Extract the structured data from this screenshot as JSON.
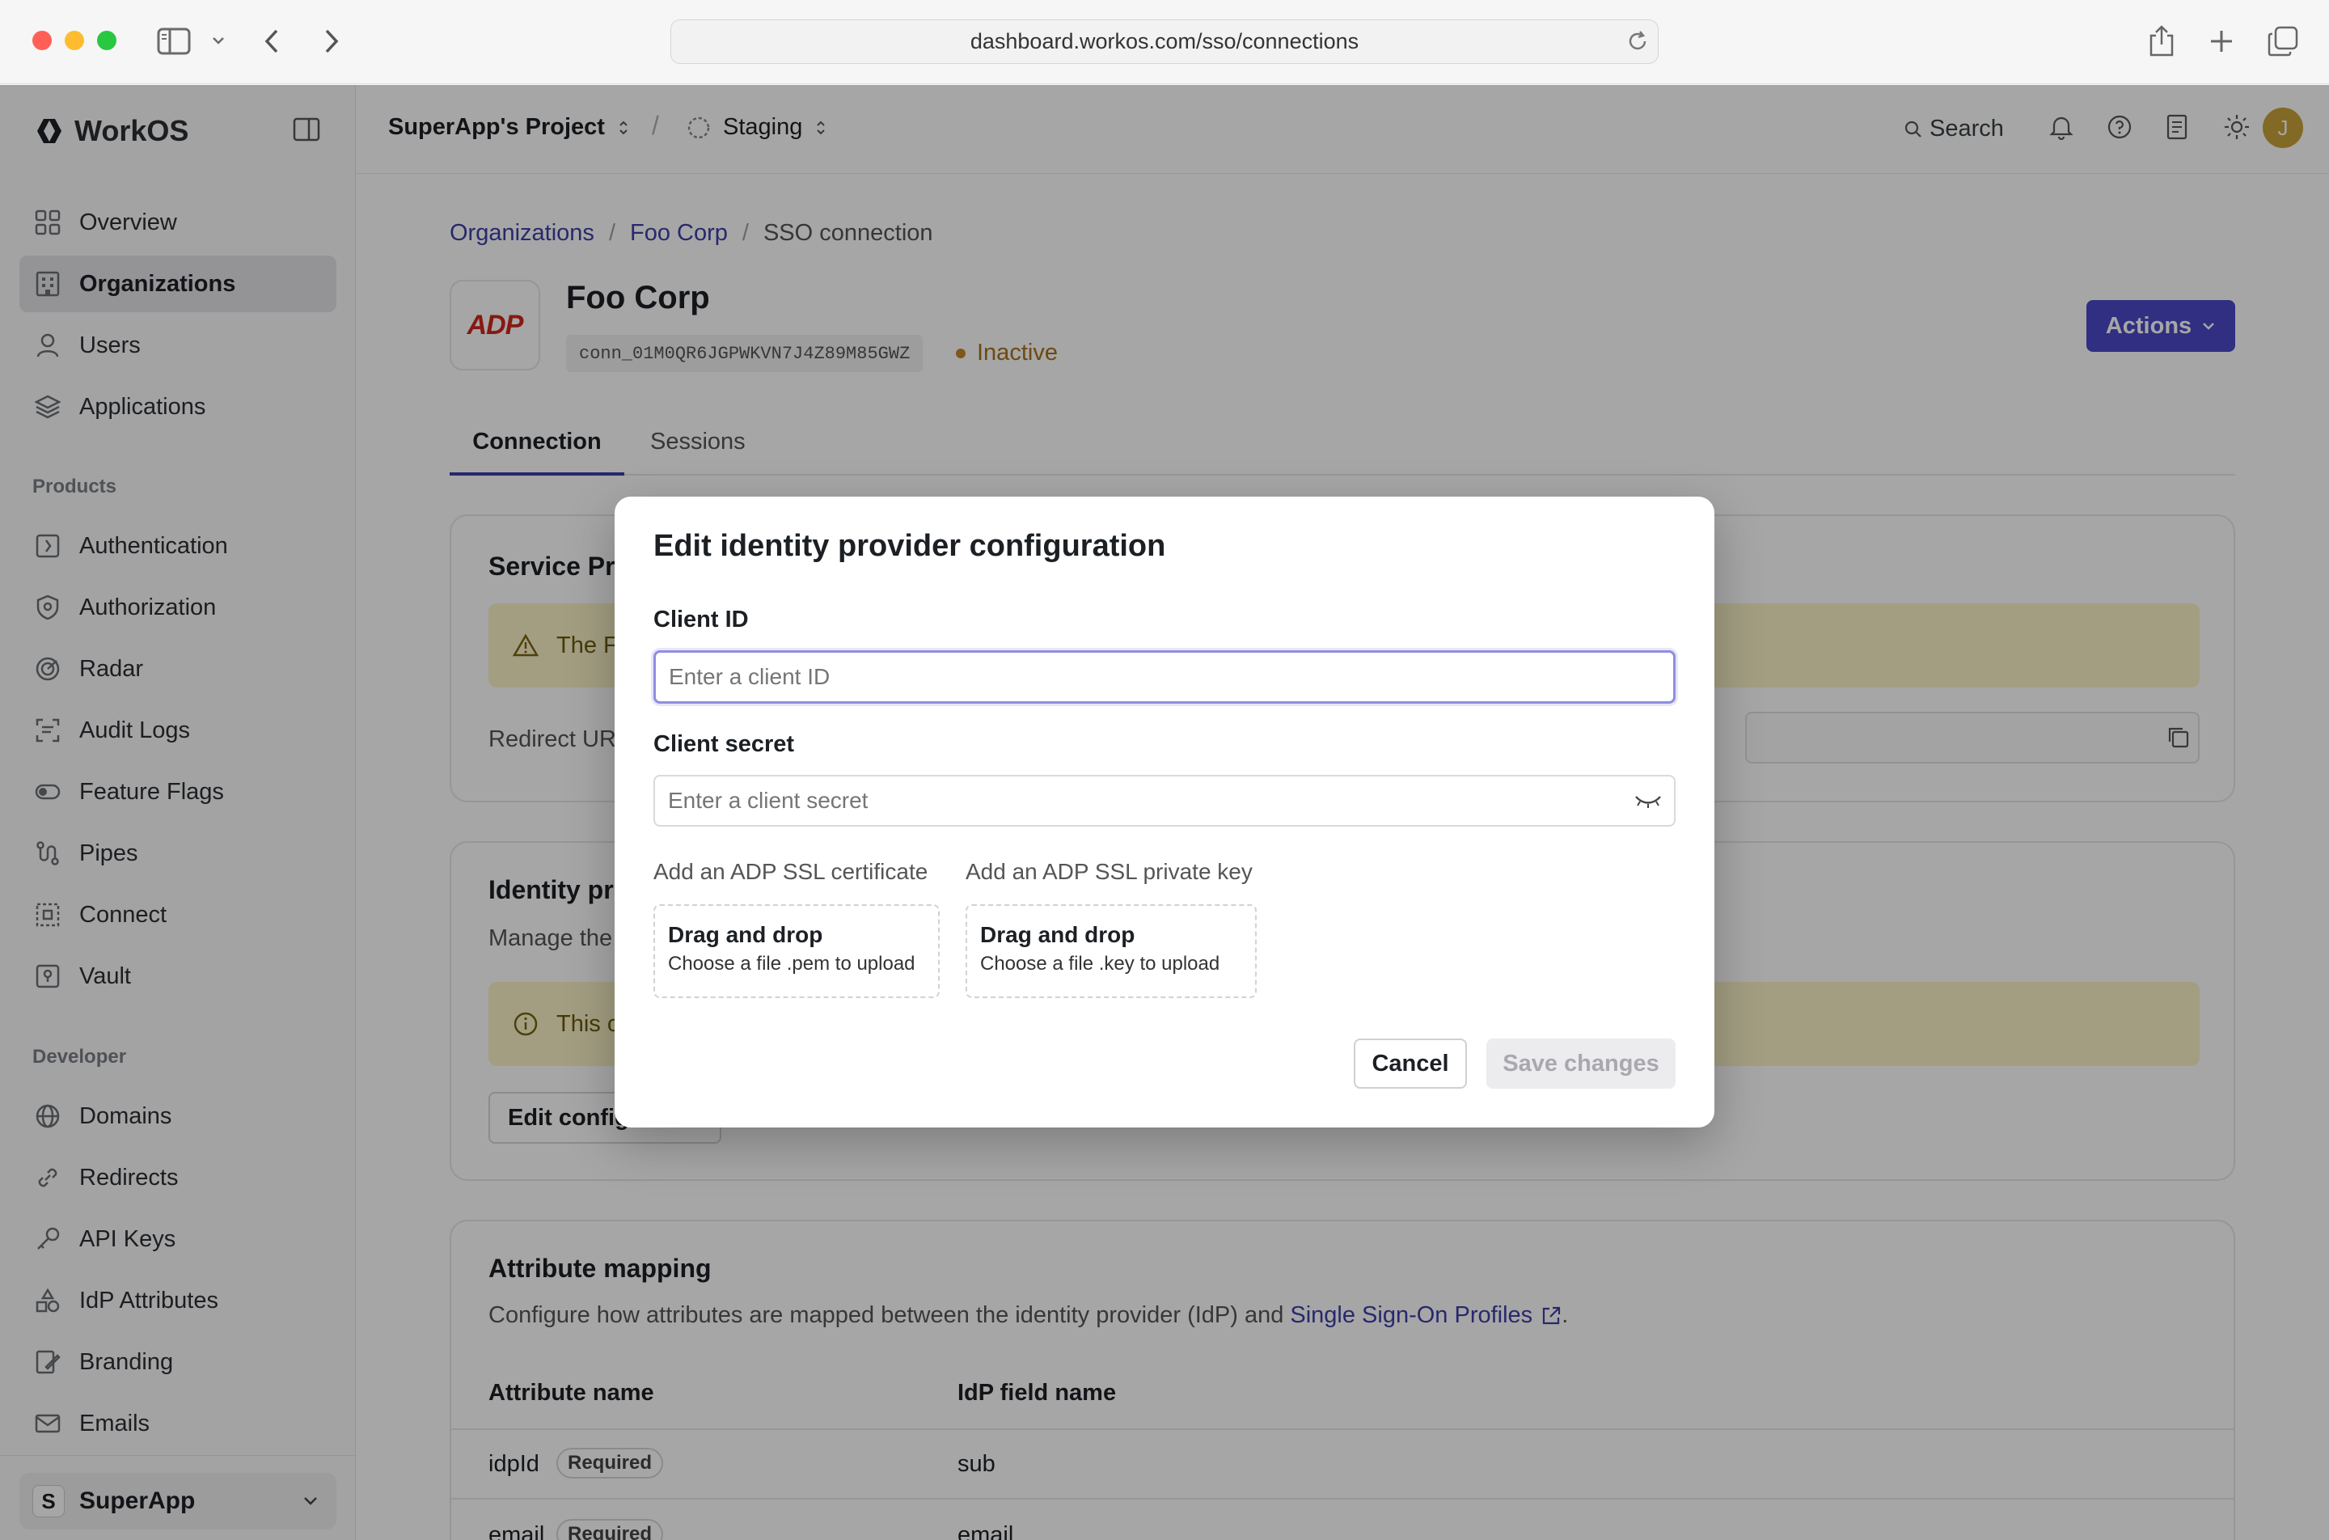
{
  "browser": {
    "url": "dashboard.workos.com/sso/connections"
  },
  "sidebar": {
    "brand": "WorkOS",
    "main_items": [
      {
        "label": "Overview",
        "icon": "grid-icon"
      },
      {
        "label": "Organizations",
        "icon": "building-icon",
        "active": true
      },
      {
        "label": "Users",
        "icon": "user-icon"
      },
      {
        "label": "Applications",
        "icon": "layers-icon"
      }
    ],
    "products_label": "Products",
    "product_items": [
      {
        "label": "Authentication",
        "icon": "key-icon"
      },
      {
        "label": "Authorization",
        "icon": "shield-icon"
      },
      {
        "label": "Radar",
        "icon": "radar-icon"
      },
      {
        "label": "Audit Logs",
        "icon": "audit-icon"
      },
      {
        "label": "Feature Flags",
        "icon": "toggle-icon"
      },
      {
        "label": "Pipes",
        "icon": "pipes-icon"
      },
      {
        "label": "Connect",
        "icon": "connect-icon"
      },
      {
        "label": "Vault",
        "icon": "vault-icon"
      }
    ],
    "developer_label": "Developer",
    "developer_items": [
      {
        "label": "Domains",
        "icon": "globe-icon"
      },
      {
        "label": "Redirects",
        "icon": "link-icon"
      },
      {
        "label": "API Keys",
        "icon": "api-key-icon"
      },
      {
        "label": "IdP Attributes",
        "icon": "shapes-icon"
      },
      {
        "label": "Branding",
        "icon": "brush-icon"
      },
      {
        "label": "Emails",
        "icon": "mail-icon"
      }
    ],
    "workspace_initial": "S",
    "workspace_name": "SuperApp"
  },
  "topbar": {
    "project": "SuperApp's Project",
    "separator": "/",
    "environment": "Staging",
    "search_label": "Search",
    "avatar_initial": "J"
  },
  "breadcrumb": {
    "items": [
      "Organizations",
      "Foo Corp",
      "SSO connection"
    ],
    "separator": "/"
  },
  "header": {
    "logo_text": "ADP",
    "title": "Foo Corp",
    "connection_id": "conn_01M0QR6JGPWKVN7J4Z89M85GWZ",
    "status": "Inactive",
    "status_color": "#c2882a",
    "actions_label": "Actions",
    "accent": "#4b49c8"
  },
  "tabs": [
    {
      "label": "Connection",
      "active": true
    },
    {
      "label": "Sessions",
      "active": false
    }
  ],
  "service_provider_card": {
    "title_partial": "Service Pr",
    "warning_partial": "The F",
    "redirect_label_partial": "Redirect UR"
  },
  "identity_card": {
    "title_partial": "Identity pr",
    "subtitle_partial": "Manage the",
    "info_partial": "This c",
    "edit_button_partial": "Edit config"
  },
  "attribute_mapping": {
    "title": "Attribute mapping",
    "description": "Configure how attributes are mapped between the identity provider (IdP) and",
    "link_text": "Single Sign-On Profiles",
    "period": ".",
    "columns": [
      "Attribute name",
      "IdP field name"
    ],
    "rows": [
      {
        "name": "idpId",
        "badge": "Required",
        "field": "sub"
      },
      {
        "name": "email",
        "badge": "Required",
        "field": "email"
      }
    ]
  },
  "modal": {
    "title": "Edit identity provider configuration",
    "client_id_label": "Client ID",
    "client_id_placeholder": "Enter a client ID",
    "client_secret_label": "Client secret",
    "client_secret_placeholder": "Enter a client secret",
    "cert_label": "Add an ADP SSL certificate",
    "key_label": "Add an ADP SSL private key",
    "cert_drop_title": "Drag and drop",
    "cert_drop_hint": "Choose a file .pem to upload",
    "key_drop_title": "Drag and drop",
    "key_drop_hint": "Choose a file .key to upload",
    "cancel_label": "Cancel",
    "save_label": "Save changes"
  }
}
